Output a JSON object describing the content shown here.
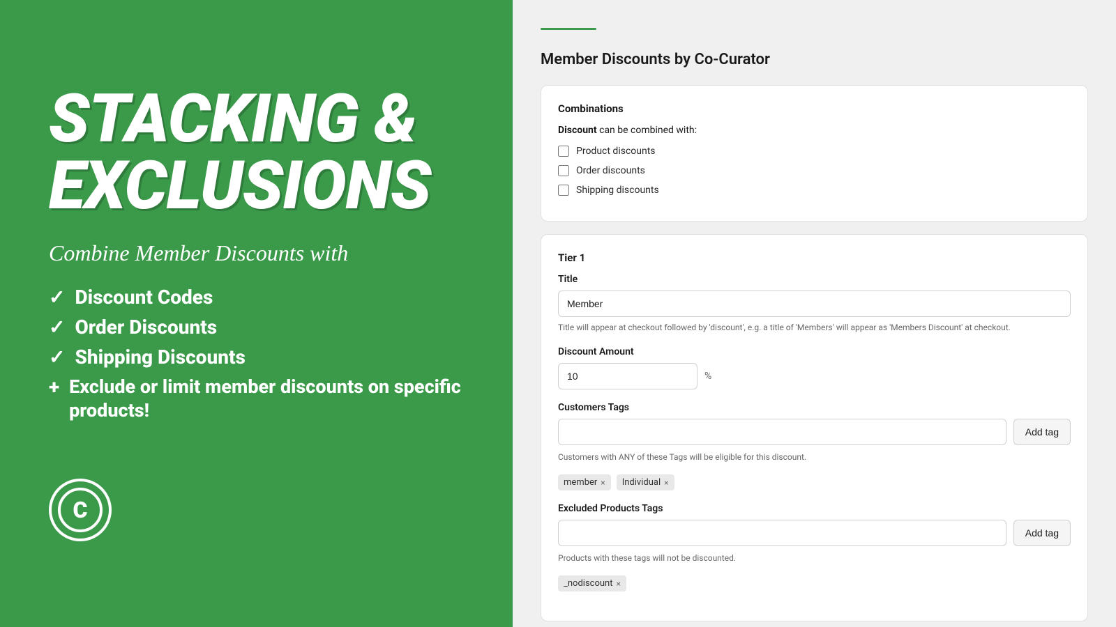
{
  "left": {
    "main_title_line1": "STACKING &",
    "main_title_line2": "EXCLUSIONS",
    "subtitle": "Combine Member Discounts with",
    "features": [
      {
        "icon": "✓",
        "type": "check",
        "label": "Discount Codes"
      },
      {
        "icon": "✓",
        "type": "check",
        "label": "Order Discounts"
      },
      {
        "icon": "✓",
        "type": "check",
        "label": "Shipping Discounts"
      }
    ],
    "extra_icon": "+",
    "extra_text": "Exclude or limit member discounts on specific products!"
  },
  "right": {
    "page_title": "Member Discounts by Co-Curator",
    "combinations_card": {
      "title": "Combinations",
      "description_prefix": "Discount",
      "description_suffix": "can be combined with:",
      "checkboxes": [
        {
          "id": "product-discounts",
          "label": "Product discounts",
          "checked": false
        },
        {
          "id": "order-discounts",
          "label": "Order discounts",
          "checked": false
        },
        {
          "id": "shipping-discounts",
          "label": "Shipping discounts",
          "checked": false
        }
      ]
    },
    "tier_card": {
      "title": "Tier 1",
      "title_label": "Title",
      "title_value": "Member",
      "title_hint": "Title will appear at checkout followed by 'discount', e.g. a title of 'Members' will appear as 'Members Discount' at checkout.",
      "discount_label": "Discount Amount",
      "discount_value": "10",
      "discount_symbol": "%",
      "customers_tags_label": "Customers Tags",
      "customers_tags_placeholder": "",
      "customers_tags_btn": "Add tag",
      "customers_hint": "Customers with ANY of these Tags will be eligible for this discount.",
      "customer_tags": [
        {
          "label": "member"
        },
        {
          "label": "Individual"
        }
      ],
      "excluded_products_label": "Excluded Products Tags",
      "excluded_products_placeholder": "",
      "excluded_products_btn": "Add tag",
      "excluded_hint": "Products with these tags will not be discounted.",
      "excluded_tags": [
        {
          "label": "_nodiscount"
        }
      ]
    }
  }
}
